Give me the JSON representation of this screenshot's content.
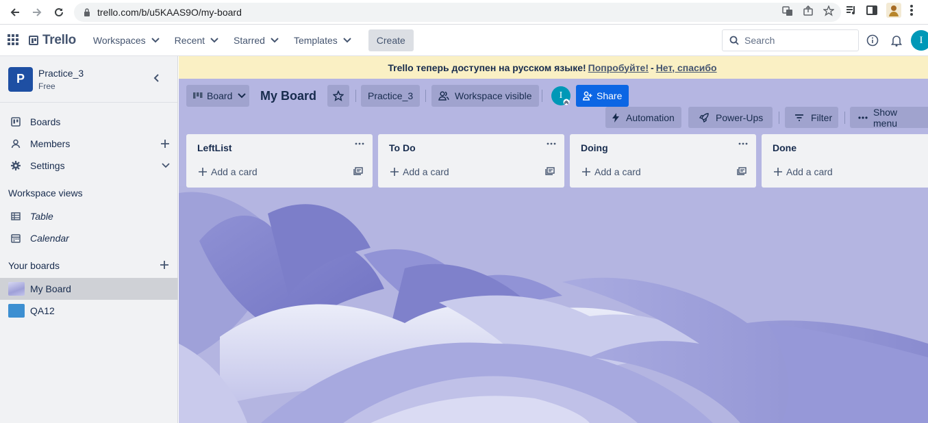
{
  "browser": {
    "url": "trello.com/b/u5KAAS9O/my-board"
  },
  "header": {
    "logo": "Trello",
    "menu": [
      {
        "label": "Workspaces"
      },
      {
        "label": "Recent"
      },
      {
        "label": "Starred"
      },
      {
        "label": "Templates"
      }
    ],
    "create_label": "Create",
    "search_placeholder": "Search",
    "avatar_initial": "I"
  },
  "sidebar": {
    "workspace_initial": "P",
    "workspace_name": "Practice_3",
    "workspace_plan": "Free",
    "items": [
      {
        "label": "Boards",
        "icon": "board-icon"
      },
      {
        "label": "Members",
        "icon": "person-icon"
      },
      {
        "label": "Settings",
        "icon": "gear-icon"
      }
    ],
    "views_heading": "Workspace views",
    "views": [
      {
        "label": "Table",
        "icon": "table-icon"
      },
      {
        "label": "Calendar",
        "icon": "calendar-icon"
      }
    ],
    "boards_heading": "Your boards",
    "boards": [
      {
        "label": "My Board",
        "color": "#b5b6e2",
        "selected": true
      },
      {
        "label": "QA12",
        "color": "#3d8fd1",
        "selected": false
      }
    ]
  },
  "banner": {
    "text": "Trello теперь доступен на русском языке!",
    "try_link": "Попробуйте!",
    "separator": "-",
    "decline_link": "Нет, спасибо"
  },
  "board": {
    "view_label": "Board",
    "title": "My Board",
    "workspace_label": "Practice_3",
    "visibility_label": "Workspace visible",
    "member_initial": "I",
    "share_label": "Share",
    "automation_label": "Automation",
    "powerups_label": "Power-Ups",
    "filter_label": "Filter",
    "show_menu_label": "Show menu",
    "accent": "#0c66e4"
  },
  "lists": [
    {
      "title": "LeftList",
      "add_label": "Add a card"
    },
    {
      "title": "To Do",
      "add_label": "Add a card"
    },
    {
      "title": "Doing",
      "add_label": "Add a card"
    },
    {
      "title": "Done",
      "add_label": "Add a card"
    }
  ]
}
